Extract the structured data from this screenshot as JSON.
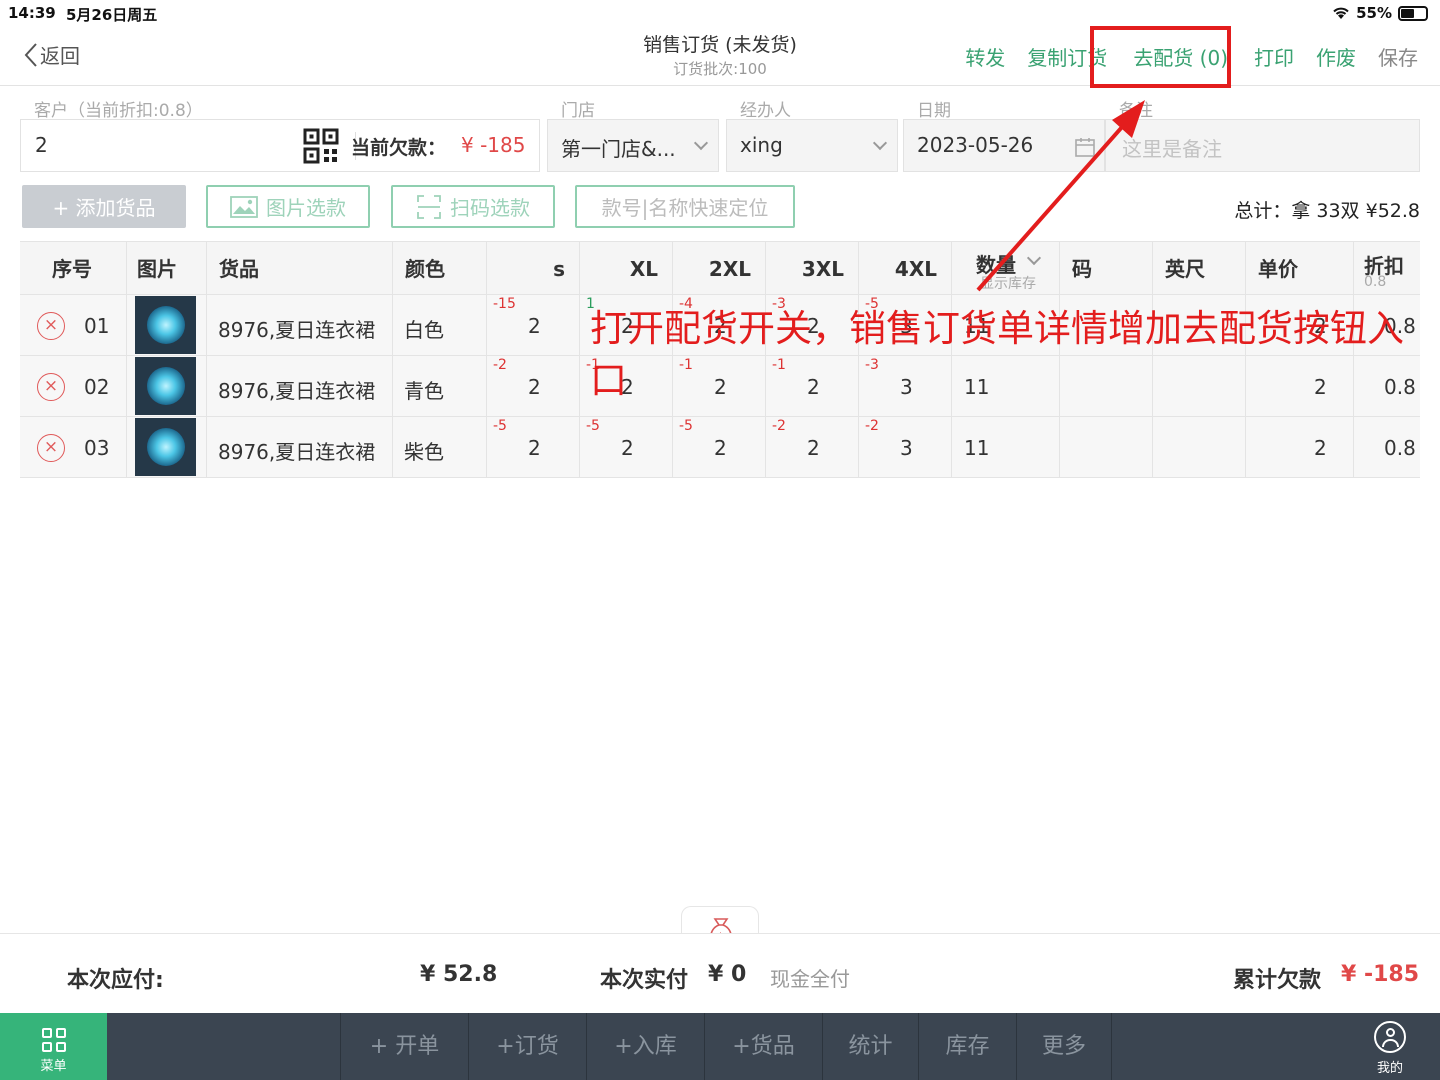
{
  "status_bar": {
    "time": "14:39",
    "date": "5月26日周五",
    "battery": "55%",
    "battery_level": 0.55
  },
  "nav": {
    "back_label": "返回",
    "title": "销售订货 (未发货)",
    "subtitle": "订货批次:100",
    "actions": {
      "forward": "转发",
      "copy": "复制订货",
      "allocate": "去配货 (0)",
      "print": "打印",
      "void": "作废",
      "save": "保存"
    }
  },
  "form": {
    "customer_label": "客户（当前折扣:0.8）",
    "customer_value": "2",
    "debt_label": "当前欠款：",
    "debt_value": "¥ -185",
    "store_label": "门店",
    "store_value": "第一门店&...",
    "handler_label": "经办人",
    "handler_value": "xing",
    "date_label": "日期",
    "date_value": "2023-05-26",
    "remark_label": "备注",
    "remark_placeholder": "这里是备注"
  },
  "toolbar": {
    "add_goods": "+ 添加货品",
    "image_select": "图片选款",
    "scan_select": "扫码选款",
    "quick_locate": "款号|名称快速定位",
    "total": "总计：拿 33双  ¥52.8"
  },
  "table": {
    "headers": {
      "seq": "序号",
      "image": "图片",
      "goods": "货品",
      "color": "颜色",
      "s": "s",
      "xl": "XL",
      "xxl": "2XL",
      "xxxl": "3XL",
      "xxxxl": "4XL",
      "qty": "数量",
      "qty_sub": "显示库存",
      "code": "码",
      "inch": "英尺",
      "price": "单价",
      "discount": "折扣",
      "discount_sub": "0.8"
    },
    "rows": [
      {
        "seq": "01",
        "goods": "8976,夏日连衣裙",
        "color": "白色",
        "sizes": [
          {
            "stock": "-15",
            "qty": "2"
          },
          {
            "stock": "1",
            "qty": "2"
          },
          {
            "stock": "-4",
            "qty": "2"
          },
          {
            "stock": "-3",
            "qty": "2"
          },
          {
            "stock": "-5",
            "qty": "3"
          }
        ],
        "qty": "11",
        "code": "",
        "inch": "",
        "price": "2",
        "discount": "0.8"
      },
      {
        "seq": "02",
        "goods": "8976,夏日连衣裙",
        "color": "青色",
        "sizes": [
          {
            "stock": "-2",
            "qty": "2"
          },
          {
            "stock": "-1",
            "qty": "2"
          },
          {
            "stock": "-1",
            "qty": "2"
          },
          {
            "stock": "-1",
            "qty": "2"
          },
          {
            "stock": "-3",
            "qty": "3"
          }
        ],
        "qty": "11",
        "code": "",
        "inch": "",
        "price": "2",
        "discount": "0.8"
      },
      {
        "seq": "03",
        "goods": "8976,夏日连衣裙",
        "color": "柴色",
        "sizes": [
          {
            "stock": "-5",
            "qty": "2"
          },
          {
            "stock": "-5",
            "qty": "2"
          },
          {
            "stock": "-5",
            "qty": "2"
          },
          {
            "stock": "-2",
            "qty": "2"
          },
          {
            "stock": "-2",
            "qty": "3"
          }
        ],
        "qty": "11",
        "code": "",
        "inch": "",
        "price": "2",
        "discount": "0.8"
      }
    ]
  },
  "annotation": "打开配货开关，销售订货单详情增加去配货按钮入口",
  "footer": {
    "payable_label": "本次应付:",
    "payable_value": "¥ 52.8",
    "paid_label": "本次实付",
    "paid_value": "¥ 0",
    "pay_mode": "现金全付",
    "debt_label": "累计欠款",
    "debt_value": "¥ -185"
  },
  "bottom_nav": {
    "menu": "菜单",
    "tabs": [
      "+ 开单",
      "+订货",
      "+入库",
      "+货品",
      "统计",
      "库存",
      "更多"
    ],
    "me": "我的"
  },
  "colors": {
    "accent": "#3aa272",
    "red": "#e31d1d",
    "bottom_bar": "#3b4551"
  }
}
